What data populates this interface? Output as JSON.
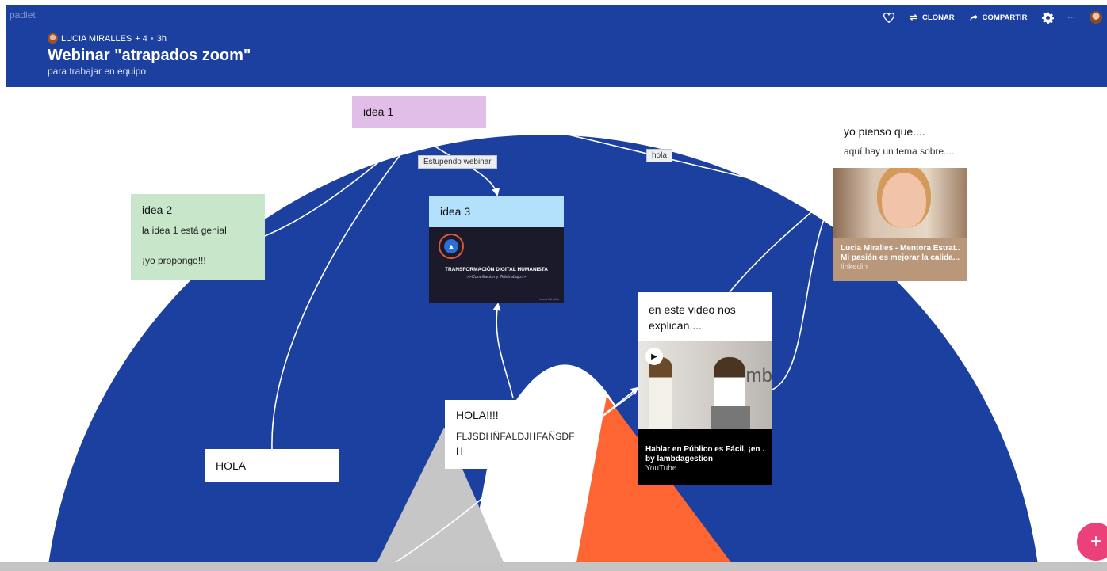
{
  "header": {
    "brand": "padlet",
    "author": "LUCIA MIRALLES",
    "contributors": "+ 4",
    "separator": "•",
    "time": "3h",
    "title": "Webinar \"atrapados zoom\"",
    "subtitle": "para trabajar en equipo",
    "toolbar": {
      "like_icon": "heart-icon",
      "clone_label": "CLONAR",
      "share_label": "COMPARTIR",
      "settings_icon": "gear-icon",
      "more_label": "···"
    }
  },
  "cards": {
    "idea1": {
      "title": "idea 1"
    },
    "idea2": {
      "title": "idea 2",
      "body": "la idea 1 está genial",
      "body2": "¡yo propongo!!!"
    },
    "idea3": {
      "title": "idea 3",
      "image_title": "TRANSFORMACIÓN DIGITAL HUMANISTA",
      "image_subtitle": ">>Conciliación y Teletrabajo>>",
      "image_credit": "Lucía Miralles"
    },
    "hola": {
      "title": "HOLA"
    },
    "hola2": {
      "title": "HOLA!!!!",
      "body": "FLJSDHÑFALDJHFAÑSDF H"
    },
    "video": {
      "title": "en este video nos explican....",
      "video_title": "Hablar en Público es Fácil, ¡en ...",
      "channel": "by lambdagestion",
      "source": "YouTube",
      "thumb_text": "mb"
    },
    "yopienso": {
      "title": "yo pienso que....",
      "body": "aquí hay un tema sobre....",
      "link_title": "Lucia Miralles - Mentora Estrat...",
      "link_desc": "Mi pasión es mejorar la calida...",
      "link_source": "linkedin"
    }
  },
  "connections": {
    "label_estupendo": "Estupendo webinar",
    "label_hola": "hola"
  },
  "fab": {
    "label": "+"
  },
  "colors": {
    "header": "#1c40a0",
    "background_blue": "#1c40a0",
    "orange": "#ff6533",
    "gray": "#c6c6c6",
    "fab": "#ec407a"
  }
}
